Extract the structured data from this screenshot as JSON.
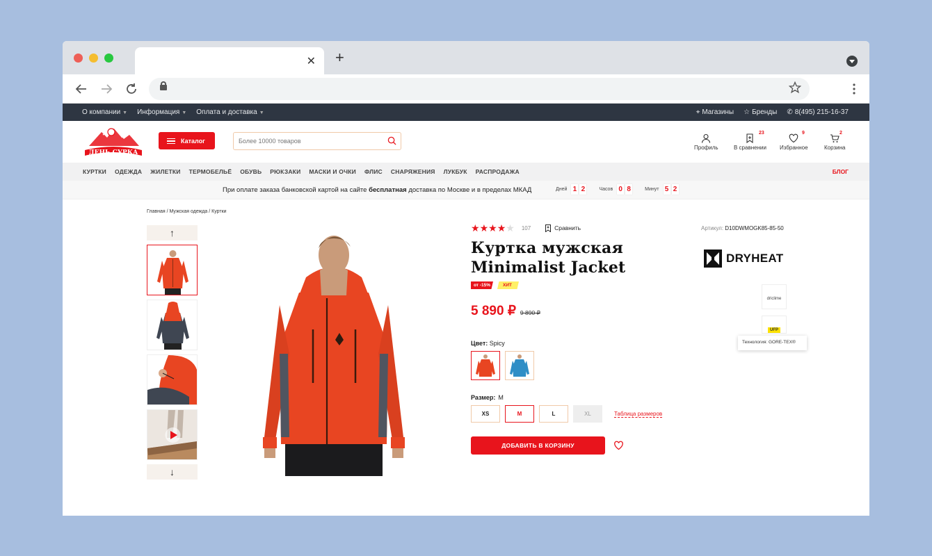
{
  "browser": {
    "close_tab": "✕",
    "new_tab": "+"
  },
  "topbar": {
    "left": [
      "О компании",
      "Информация",
      "Оплата и доставка"
    ],
    "stores": "Магазины",
    "brands": "Бренды",
    "phone": "8(495) 215-16-37"
  },
  "header": {
    "logo_text": "ДЕНЬ СУРКА",
    "catalog": "Каталог",
    "search_placeholder": "Более 10000 товаров",
    "profile": "Профиль",
    "compare": "В сравнении",
    "compare_count": "23",
    "favorites": "Избранное",
    "favorites_count": "9",
    "cart": "Корзина",
    "cart_count": "2"
  },
  "menu": {
    "items": [
      "КУРТКИ",
      "ОДЕЖДА",
      "ЖИЛЕТКИ",
      "ТЕРМОБЕЛЬЁ",
      "ОБУВЬ",
      "РЮКЗАКИ",
      "МАСКИ И ОЧКИ",
      "ФЛИС",
      "СНАРЯЖЕНИЯ",
      "ЛУКБУК",
      "РАСПРОДАЖА"
    ],
    "blog": "БЛОГ"
  },
  "promo": {
    "text_before": "При оплате заказа банковской картой на сайте ",
    "text_bold": "бесплатная",
    "text_after": " доставка по Москве и в пределах МКАД",
    "days_label": "Дней",
    "days": [
      "1",
      "2"
    ],
    "hours_label": "Часов",
    "hours": [
      "0",
      "8"
    ],
    "minutes_label": "Минут",
    "minutes": [
      "5",
      "2"
    ]
  },
  "breadcrumbs": "Главная  /  Мужская одежда / Куртки",
  "product": {
    "rating": 4,
    "reviews": "107",
    "compare": "Сравнить",
    "title_line1": "Куртка мужская",
    "title_line2": "Minimalist Jacket",
    "tag_sale": "от -15%",
    "tag_hit": "ХИТ",
    "price": "5 890 ₽",
    "old_price": "9 890 ₽",
    "color_label": "Цвет:",
    "color_value": "Spicy",
    "size_label": "Размер:",
    "size_value": "M",
    "sizes": [
      "XS",
      "M",
      "L",
      "XL"
    ],
    "size_table": "Таблица размеров",
    "add_to_cart": "ДОБАВИТЬ В КОРЗИНУ",
    "sku_label": "Артикул:",
    "sku": "D10DWMOGK85-85-50",
    "brand": "DRYHEAT",
    "tech1": "driclime",
    "tech2": "UFP",
    "tooltip": "Технология: GORE-TEX®"
  },
  "colors": {
    "accent": "#e8141c",
    "topbar": "#2e3642",
    "jacket": "#e84522",
    "jacket_alt": "#2f8ec6"
  }
}
